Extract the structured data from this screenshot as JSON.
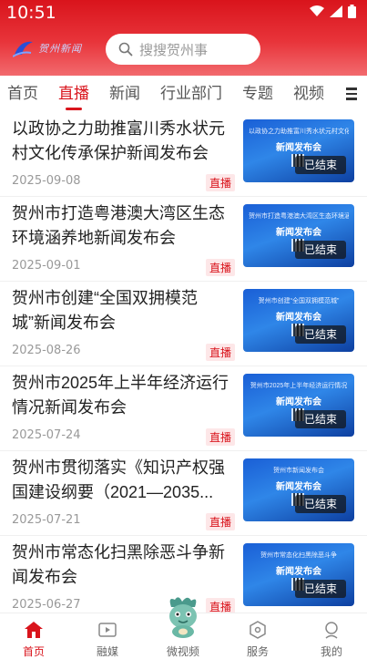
{
  "status_bar": {
    "time": "10:51"
  },
  "header": {
    "logo_text": "贺州新闻",
    "search": {
      "placeholder": "搜搜贺州事"
    }
  },
  "tabs": [
    {
      "label": "首页",
      "active": false
    },
    {
      "label": "直播",
      "active": true
    },
    {
      "label": "新闻",
      "active": false
    },
    {
      "label": "行业部门",
      "active": false
    },
    {
      "label": "专题",
      "active": false
    },
    {
      "label": "视频",
      "active": false
    }
  ],
  "news": [
    {
      "title": "以政协之力助推富川秀水状元村文化传承保护新闻发布会",
      "date": "2025-09-08",
      "badge": "直播",
      "thumb_line1": "以政协之力助推富川秀水状元村文化传承保护",
      "thumb_line2": "新闻发布会",
      "thumb_status": "已结束"
    },
    {
      "title": "贺州市打造粤港澳大湾区生态环境涵养地新闻发布会",
      "date": "2025-09-01",
      "badge": "直播",
      "thumb_line1": "贺州市打造粤港澳大湾区生态环境涵养地",
      "thumb_line2": "新闻发布会",
      "thumb_status": "已结束"
    },
    {
      "title": "贺州市创建“全国双拥模范城”新闻发布会",
      "date": "2025-08-26",
      "badge": "直播",
      "thumb_line1": "贺州市创建“全国双拥模范城”",
      "thumb_line2": "新闻发布会",
      "thumb_status": "已结束"
    },
    {
      "title": "贺州市2025年上半年经济运行情况新闻发布会",
      "date": "2025-07-24",
      "badge": "直播",
      "thumb_line1": "贺州市2025年上半年经济运行情况",
      "thumb_line2": "新闻发布会",
      "thumb_status": "已结束"
    },
    {
      "title": "贺州市贯彻落实《知识产权强国建设纲要（2021—2035...",
      "date": "2025-07-21",
      "badge": "直播",
      "thumb_line1": "贺州市新闻发布会",
      "thumb_line2": "新闻发布会",
      "thumb_status": "已结束"
    },
    {
      "title": "贺州市常态化扫黑除恶斗争新闻发布会",
      "date": "2025-06-27",
      "badge": "直播",
      "thumb_line1": "贺州市常态化扫黑除恶斗争",
      "thumb_line2": "新闻发布会",
      "thumb_status": "已结束"
    }
  ],
  "bottom_nav": [
    {
      "label": "首页",
      "icon": "home-icon",
      "active": true
    },
    {
      "label": "融媒",
      "icon": "media-icon",
      "active": false
    },
    {
      "label": "微视频",
      "icon": "mascot-icon",
      "active": false
    },
    {
      "label": "服务",
      "icon": "service-icon",
      "active": false
    },
    {
      "label": "我的",
      "icon": "profile-icon",
      "active": false
    }
  ],
  "colors": {
    "accent": "#d9141c",
    "header_gradient_end": "#f26a6e",
    "thumb_blue": "#1a5fd6"
  }
}
